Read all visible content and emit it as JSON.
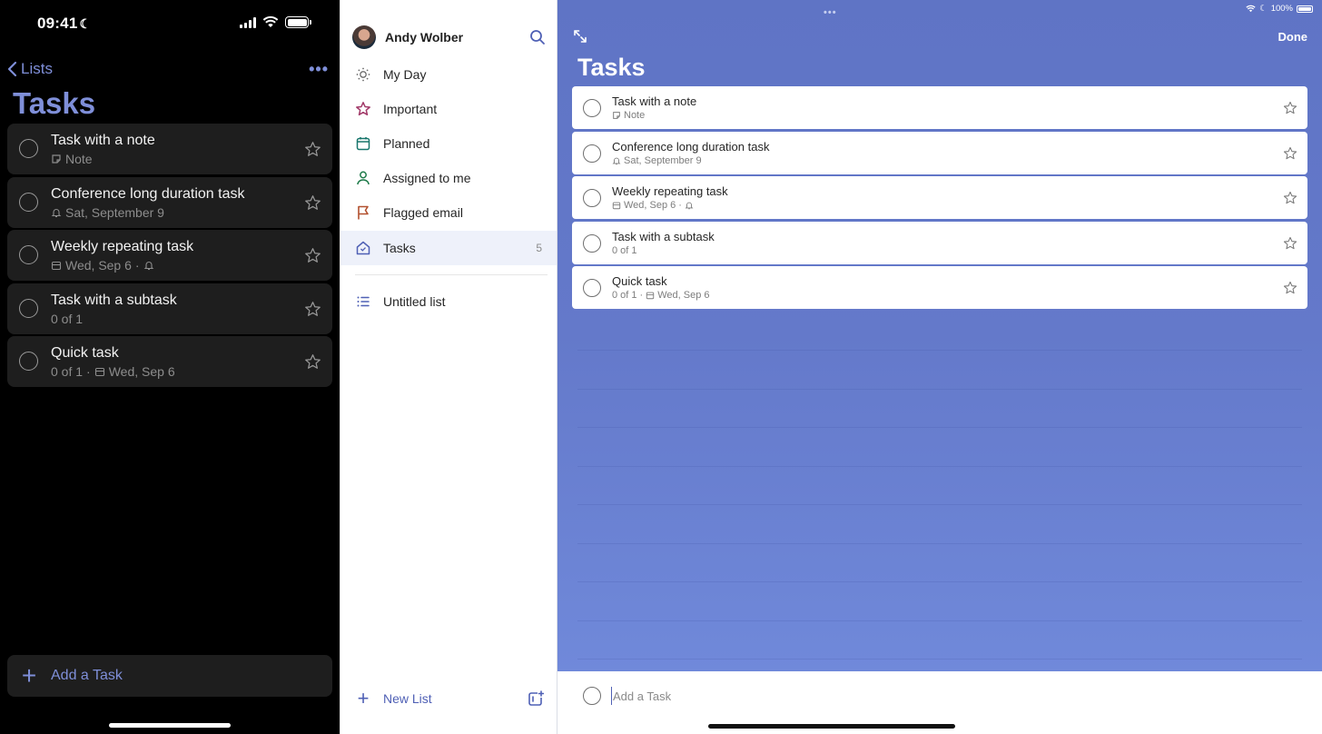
{
  "phone": {
    "status": {
      "time": "09:41"
    },
    "nav": {
      "back_label": "Lists",
      "more_label": "•••"
    },
    "title": "Tasks",
    "tasks": [
      {
        "title": "Task with a note",
        "meta": [
          {
            "icon": "note-icon",
            "text": "Note"
          }
        ]
      },
      {
        "title": "Conference long duration task",
        "meta": [
          {
            "icon": "bell-icon",
            "text": "Sat, September 9"
          }
        ]
      },
      {
        "title": "Weekly repeating task",
        "meta": [
          {
            "icon": "calendar-icon",
            "text": "Wed, Sep 6"
          },
          {
            "icon": "bell-icon",
            "text": ""
          }
        ]
      },
      {
        "title": "Task with a subtask",
        "meta": [
          {
            "icon": "",
            "text": "0 of 1"
          }
        ]
      },
      {
        "title": "Quick task",
        "meta": [
          {
            "icon": "",
            "text": "0 of 1"
          },
          {
            "icon": "calendar-icon",
            "text": "Wed, Sep 6"
          }
        ]
      }
    ],
    "add_task_label": "Add a Task",
    "accent": "#7f8fd9"
  },
  "sidebar": {
    "user_name": "Andy Wolber",
    "items": [
      {
        "label": "My Day",
        "icon": "sun-icon",
        "color": "#6b6b6b",
        "count": ""
      },
      {
        "label": "Important",
        "icon": "star-icon",
        "color": "#a23a69",
        "count": ""
      },
      {
        "label": "Planned",
        "icon": "calendar-icon",
        "color": "#18766c",
        "count": ""
      },
      {
        "label": "Assigned to me",
        "icon": "person-icon",
        "color": "#1d7a49",
        "count": ""
      },
      {
        "label": "Flagged email",
        "icon": "flag-icon",
        "color": "#b2502e",
        "count": ""
      },
      {
        "label": "Tasks",
        "icon": "house-icon",
        "color": "#4f60b5",
        "count": "5",
        "selected": true
      },
      {
        "label": "Untitled list",
        "icon": "list-icon",
        "color": "#4f60b5",
        "count": ""
      }
    ],
    "new_list_label": "New List",
    "accent": "#4f60b5"
  },
  "main": {
    "status": {
      "battery": "100%"
    },
    "done_label": "Done",
    "title": "Tasks",
    "tasks": [
      {
        "title": "Task with a note",
        "meta": [
          {
            "icon": "note-icon",
            "text": "Note"
          }
        ]
      },
      {
        "title": "Conference long duration task",
        "meta": [
          {
            "icon": "bell-icon",
            "text": "Sat, September 9"
          }
        ]
      },
      {
        "title": "Weekly repeating task",
        "meta": [
          {
            "icon": "calendar-icon",
            "text": "Wed, Sep 6"
          },
          {
            "icon": "bell-icon",
            "text": ""
          }
        ]
      },
      {
        "title": "Task with a subtask",
        "meta": [
          {
            "icon": "",
            "text": "0 of 1"
          }
        ]
      },
      {
        "title": "Quick task",
        "meta": [
          {
            "icon": "",
            "text": "0 of 1"
          },
          {
            "icon": "calendar-icon",
            "text": "Wed, Sep 6"
          }
        ]
      }
    ],
    "add_task_placeholder": "Add a Task",
    "add_task_value": "",
    "background": "#6479ca"
  }
}
